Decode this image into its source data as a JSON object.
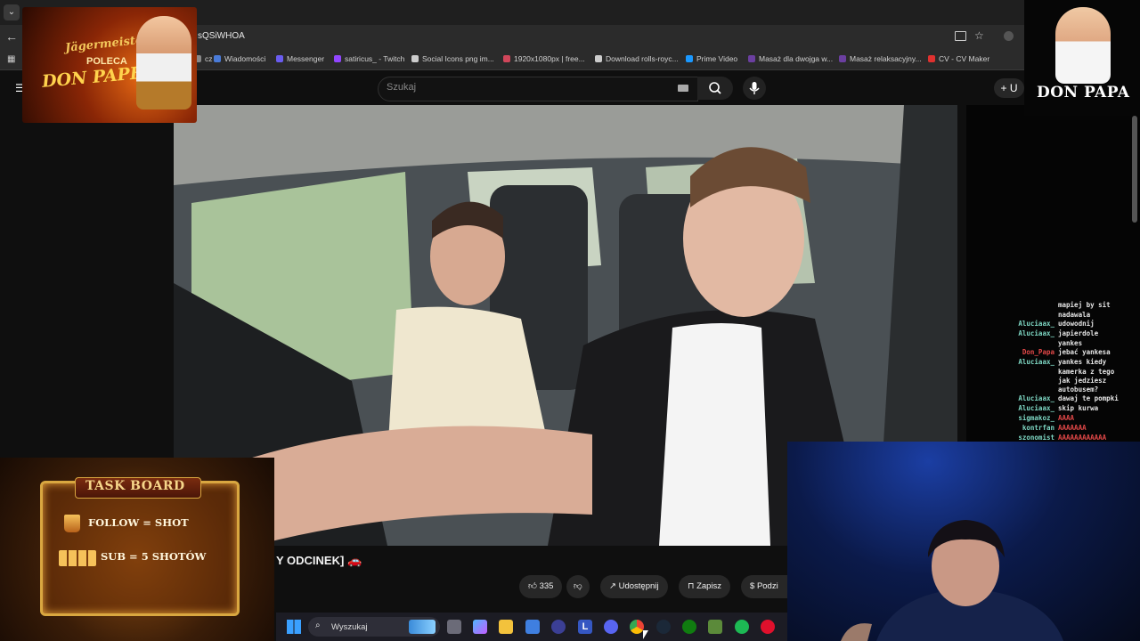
{
  "browser": {
    "url": "sQSiWHOA",
    "bookmarks": [
      {
        "label": "cz",
        "color": "#888888"
      },
      {
        "label": "Wiadomości",
        "color": "#4a7bd8"
      },
      {
        "label": "Messenger",
        "color": "#6a5cf0"
      },
      {
        "label": "satiricus_ - Twitch",
        "color": "#9146ff"
      },
      {
        "label": "Social Icons png im...",
        "color": "#cccccc"
      },
      {
        "label": "1920x1080px | free...",
        "color": "#d0465a"
      },
      {
        "label": "Download rolls-royc...",
        "color": "#cccccc"
      },
      {
        "label": "Prime Video",
        "color": "#1a98ff"
      },
      {
        "label": "Masaż dla dwojga w...",
        "color": "#6b3fa0"
      },
      {
        "label": "Masaż relaksacyjny...",
        "color": "#6b3fa0"
      },
      {
        "label": "CV - CV Maker",
        "color": "#e0312f"
      }
    ]
  },
  "youtube": {
    "search_placeholder": "Szukaj",
    "create_label": "+ U",
    "video_title": "Y ODCINEK]",
    "actions": {
      "like_count": "335",
      "share_label": "Udostępnij",
      "save_label": "Zapisz",
      "more_label": "Podzi"
    }
  },
  "chat": {
    "lines": [
      {
        "user": "",
        "text": "mapiej by sit"
      },
      {
        "user": "",
        "text": "nadawala"
      },
      {
        "user": "Aluciaax_",
        "text": "udowodnij"
      },
      {
        "user": "Aluciaax_",
        "text": "japierdole"
      },
      {
        "user": "",
        "text": "yankes"
      },
      {
        "user": "Don_Papa",
        "text": "jebać yankesa",
        "user_color": "red"
      },
      {
        "user": "Aluciaax_",
        "text": "yankes kiedy"
      },
      {
        "user": "",
        "text": "kamerka z tego"
      },
      {
        "user": "",
        "text": "jak jedziesz"
      },
      {
        "user": "",
        "text": "autobusem?"
      },
      {
        "user": "Aluciaax_",
        "text": "dawaj te pompki"
      },
      {
        "user": "Aluciaax_",
        "text": "skip kurwa"
      },
      {
        "user": "sigmakoz_",
        "text": "AAAA",
        "text_color": "red"
      },
      {
        "user": "kontrfan",
        "text": "AAAAAAA",
        "text_color": "red"
      },
      {
        "user": "szonomist",
        "text": "AAAAAAAAAAAA",
        "text_color": "red"
      }
    ]
  },
  "overlays": {
    "promo": {
      "brand": "Jägermeister",
      "line1": "POLECA",
      "line2": "DON PAPE"
    },
    "logo_text": "DON PAPA",
    "task_board": {
      "title": "TASK BOARD",
      "tasks": [
        "FOLLOW = SHOT",
        "SUB = 5 SHOTÓW"
      ]
    }
  },
  "taskbar": {
    "search_label": "Wyszukaj",
    "icons": [
      "windows-start",
      "task-view",
      "copilot",
      "file-explorer",
      "store",
      "vpn",
      "launcher-l",
      "discord",
      "chrome",
      "steam",
      "xbox",
      "minecraft",
      "spotify",
      "opera"
    ]
  }
}
